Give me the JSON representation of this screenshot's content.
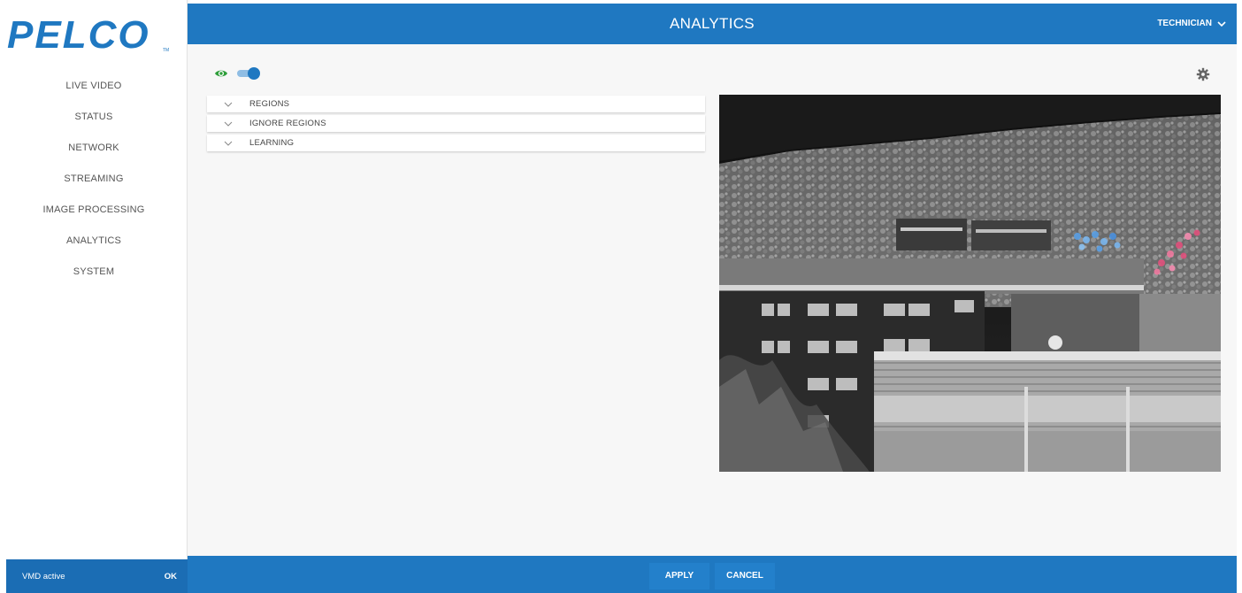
{
  "brand": {
    "logo_text": "PELCO",
    "trademark": "TM",
    "accent": "#1f78c1"
  },
  "sidebar": {
    "items": [
      {
        "label": "LIVE VIDEO"
      },
      {
        "label": "STATUS"
      },
      {
        "label": "NETWORK"
      },
      {
        "label": "STREAMING"
      },
      {
        "label": "IMAGE PROCESSING"
      },
      {
        "label": "ANALYTICS"
      },
      {
        "label": "SYSTEM"
      }
    ]
  },
  "header": {
    "title": "ANALYTICS",
    "user": "TECHNICIAN",
    "user_icon": "chevron-down-icon"
  },
  "toolbar": {
    "visibility_icon": "eye-icon",
    "visibility_enabled": true,
    "settings_icon": "gear-icon"
  },
  "accordion": {
    "sections": [
      {
        "label": "REGIONS"
      },
      {
        "label": "IGNORE REGIONS"
      },
      {
        "label": "LEARNING"
      }
    ]
  },
  "status": {
    "text": "VMD active",
    "action": "OK"
  },
  "footer": {
    "apply": "APPLY",
    "cancel": "CANCEL"
  }
}
